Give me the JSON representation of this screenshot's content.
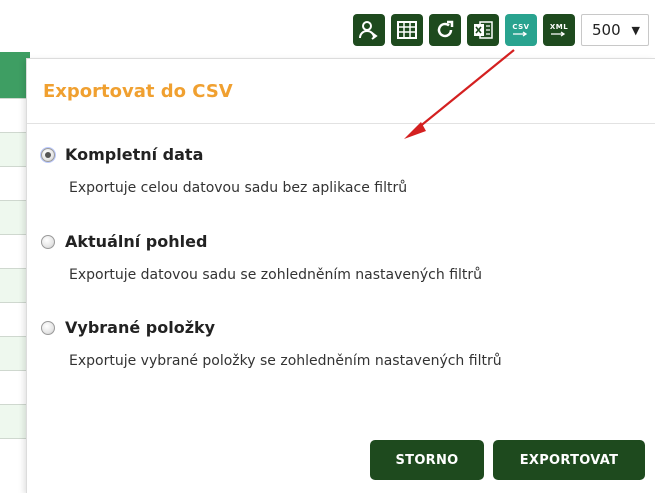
{
  "toolbar": {
    "buttons": [
      {
        "icon": "user-export-icon"
      },
      {
        "icon": "table-icon"
      },
      {
        "icon": "refresh-icon"
      },
      {
        "icon": "excel-icon"
      },
      {
        "icon": "csv-icon",
        "label": "CSV",
        "active": true
      },
      {
        "icon": "xml-icon",
        "label": "XML"
      }
    ],
    "page_size": "500",
    "page_size_caret": "▼"
  },
  "dialog": {
    "title": "Exportovat do CSV",
    "options": [
      {
        "label": "Kompletní data",
        "description": "Exportuje celou datovou sadu bez aplikace filtrů",
        "checked": true
      },
      {
        "label": "Aktuální pohled",
        "description": "Exportuje datovou sadu se zohledněním nastavených filtrů",
        "checked": false
      },
      {
        "label": "Vybrané položky",
        "description": "Exportuje vybrané položky se zohledněním nastavených filtrů",
        "checked": false
      }
    ],
    "cancel_label": "STORNO",
    "export_label": "EXPORTOVAT"
  },
  "colors": {
    "button_dark_green": "#1e4a1e",
    "csv_teal": "#29a38f",
    "title_orange": "#f0a030",
    "table_header_green": "#3e9e63",
    "annotation_red": "#d42020"
  }
}
